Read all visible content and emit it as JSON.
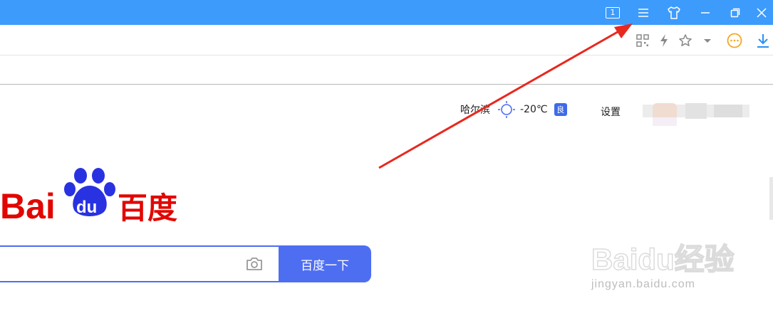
{
  "titlebar": {
    "tab_count": "1",
    "controls": [
      "menu-icon",
      "skin-icon",
      "minimize-icon",
      "restore-icon",
      "close-icon"
    ],
    "color": "#3d9bfc"
  },
  "toolbar": {
    "icons": [
      "qr-code-icon",
      "lightning-icon",
      "star-icon",
      "dropdown-icon",
      "more-icon",
      "download-icon"
    ]
  },
  "page": {
    "city": "哈尔滨",
    "temperature": "-20℃",
    "air_quality": "良",
    "settings_label": "设置",
    "logo_text_en": "Bai",
    "logo_text_du": "du",
    "logo_text_cn": "百度",
    "search": {
      "value": "",
      "button_label": "百度一下"
    },
    "watermark_main": "Baidu经验",
    "watermark_sub": "jingyan.baidu.com"
  },
  "colors": {
    "baidu_red": "#e10601",
    "baidu_blue": "#2932e1",
    "accent": "#4e6ef2",
    "annotation_arrow": "#e8281e"
  }
}
